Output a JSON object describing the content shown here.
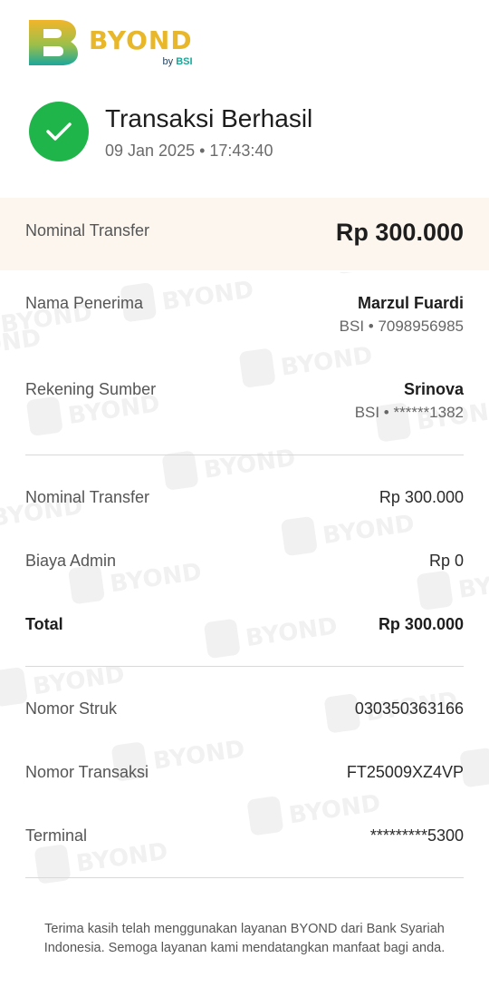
{
  "brand": {
    "name": "BYOND",
    "by_prefix": "by",
    "by_brand": "BSI",
    "colors": {
      "gold": "#e8b72a",
      "teal": "#19a89a",
      "success": "#1fb54a"
    }
  },
  "status": {
    "icon": "check-icon",
    "title": "Transaksi Berhasil",
    "datetime": "09 Jan 2025 • 17:43:40"
  },
  "summary": {
    "amount_label": "Nominal Transfer",
    "amount_value": "Rp 300.000"
  },
  "recipient": {
    "label": "Nama Penerima",
    "name": "Marzul Fuardi",
    "account": "BSI • 7098956985"
  },
  "source": {
    "label": "Rekening Sumber",
    "name": "Srinova",
    "account": "BSI • ******1382"
  },
  "breakdown": [
    {
      "label": "Nominal Transfer",
      "value": "Rp 300.000"
    },
    {
      "label": "Biaya Admin",
      "value": "Rp 0"
    },
    {
      "label": "Total",
      "value": "Rp 300.000"
    }
  ],
  "references": [
    {
      "label": "Nomor Struk",
      "value": "030350363166"
    },
    {
      "label": "Nomor Transaksi",
      "value": "FT25009XZ4VP"
    },
    {
      "label": "Terminal",
      "value": "*********5300"
    }
  ],
  "footer_text": "Terima kasih telah menggunakan layanan BYOND dari Bank Syariah Indonesia. Semoga layanan kami mendatangkan manfaat bagi anda."
}
